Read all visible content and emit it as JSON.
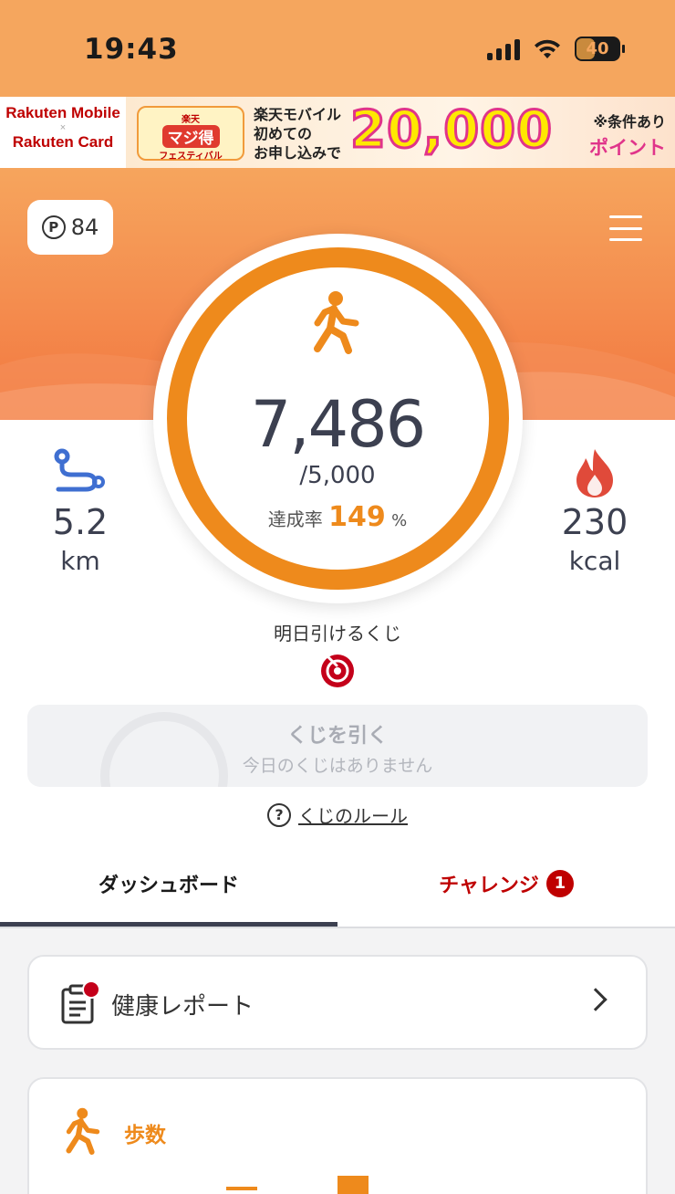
{
  "status_bar": {
    "time": "19:43",
    "battery": "40"
  },
  "ad": {
    "brand_top": "Rakuten Mobile",
    "brand_sep": "×",
    "brand_bottom": "Rakuten Card",
    "fest_small": "楽天",
    "fest_big": "マジ得",
    "fest_tiny": "フェスティバル",
    "text_lines": [
      "楽天モバイル",
      "初めての",
      "お申し込みで"
    ],
    "amount": "20,000",
    "note": "※条件あり",
    "unit": "ポイント"
  },
  "header": {
    "points": "84",
    "points_icon": "P"
  },
  "steps": {
    "value": "7,486",
    "goal": "/5,000",
    "rate_label": "達成率",
    "rate_value": "149",
    "rate_unit": "%"
  },
  "distance": {
    "value": "5.2",
    "unit": "km"
  },
  "calories": {
    "value": "230",
    "unit": "kcal"
  },
  "lottery": {
    "title": "明日引けるくじ",
    "button_label": "くじを引く",
    "button_sub": "今日のくじはありません",
    "rules_label": "くじのルール"
  },
  "tabs": {
    "dashboard": "ダッシュボード",
    "challenge": "チャレンジ",
    "challenge_badge": "1"
  },
  "cards": {
    "report": "健康レポート",
    "steps_title": "歩数"
  },
  "colors": {
    "accent": "#ee8a1c",
    "brand_red": "#bf0000",
    "header_orange": "#f5a65e"
  }
}
